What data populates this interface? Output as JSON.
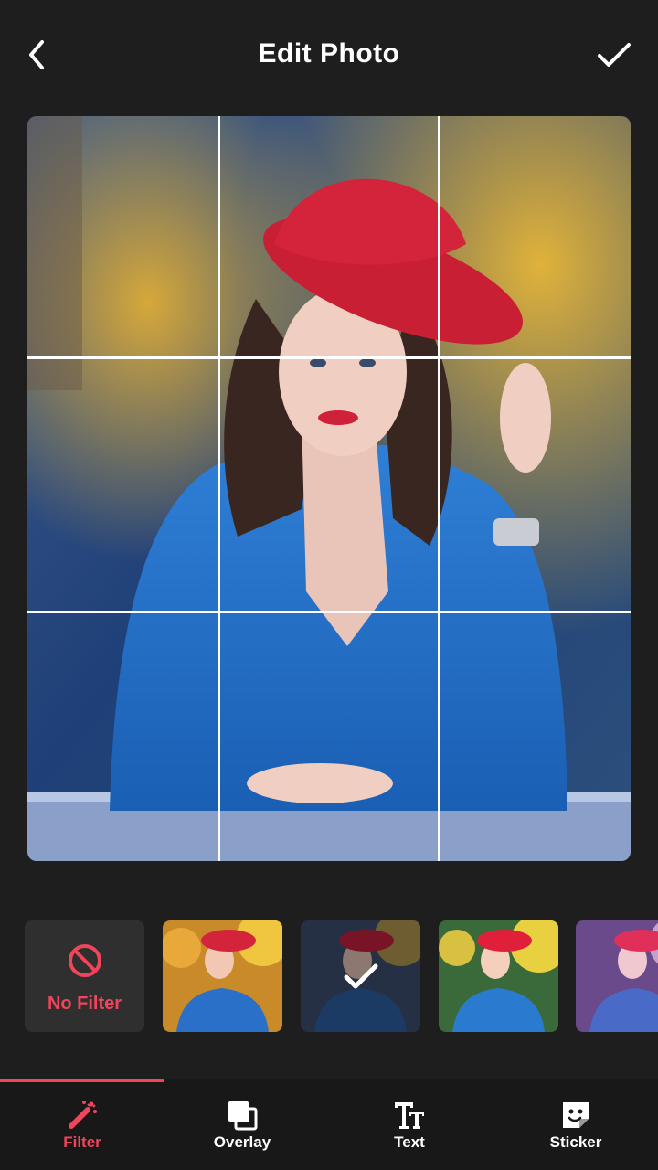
{
  "header": {
    "title": "Edit Photo",
    "back_icon": "back-arrow-icon",
    "done_icon": "checkmark-icon"
  },
  "filters": {
    "no_filter_label": "No Filter",
    "no_filter_icon": "prohibited-icon",
    "thumbnails": [
      {
        "name": "warm",
        "selected": false
      },
      {
        "name": "cool",
        "selected": true
      },
      {
        "name": "vivid",
        "selected": false
      },
      {
        "name": "purple",
        "selected": false
      }
    ]
  },
  "tabs": [
    {
      "label": "Filter",
      "icon": "magic-wand-icon",
      "active": true
    },
    {
      "label": "Overlay",
      "icon": "overlay-icon",
      "active": false
    },
    {
      "label": "Text",
      "icon": "text-icon",
      "active": false
    },
    {
      "label": "Sticker",
      "icon": "sticker-icon",
      "active": false
    }
  ],
  "colors": {
    "accent": "#f0455a",
    "background": "#1e1e1e",
    "tabbar": "#181818"
  }
}
